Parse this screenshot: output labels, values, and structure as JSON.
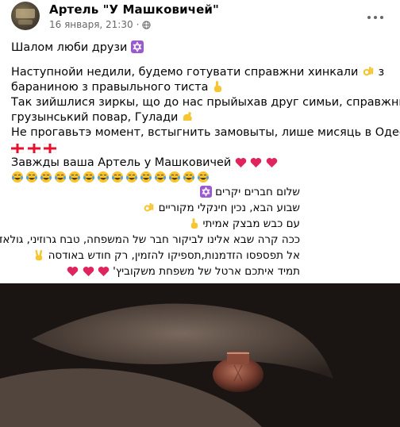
{
  "post": {
    "page_name": "Артель \"У Машковичей\"",
    "date": "16 января, 21:30",
    "dot": "·",
    "more_icon": "more-horizontal-icon",
    "privacy_icon": "globe-icon"
  },
  "text": {
    "greeting": "Шалом люби друзи",
    "l1a": "Наступнойи недили, будемо готувати  справжни хинкали",
    "l1b": "з",
    "l2": "бараниною з правыльного тиста",
    "l3": "Так зийшлися зиркы, що до нас прыйыхав друг симьи, справжний",
    "l4": "грузынський повар, Гулади",
    "l5": "Не прогавьтэ момент, встыгнить замовыты, лише мисяць в Одеси",
    "l6": "Завжды ваша Артель у Машковичей"
  },
  "hebrew": {
    "h1": "שלום חברים יקרים",
    "h2": "שבוע הבא, נכין חינקלי מקוריים",
    "h3": "עם כבש מבצק אמיתי",
    "h4": "ככה קרה שבא אלינו לביקור חבר של המשפחה, טבח גרוזיני, גולאדי",
    "h5": "אל תפספסו הזדמנות,תספיקו להזמין, רק חודש באודסה",
    "h6": "תמיד איתכם ארטל של משפחת משקוביץ'"
  },
  "colors": {
    "text": "#050505",
    "meta": "#65676b",
    "heart": "#e0245e",
    "emoji_yellow": "#f7c531",
    "star_bg": "#9b59d0"
  }
}
